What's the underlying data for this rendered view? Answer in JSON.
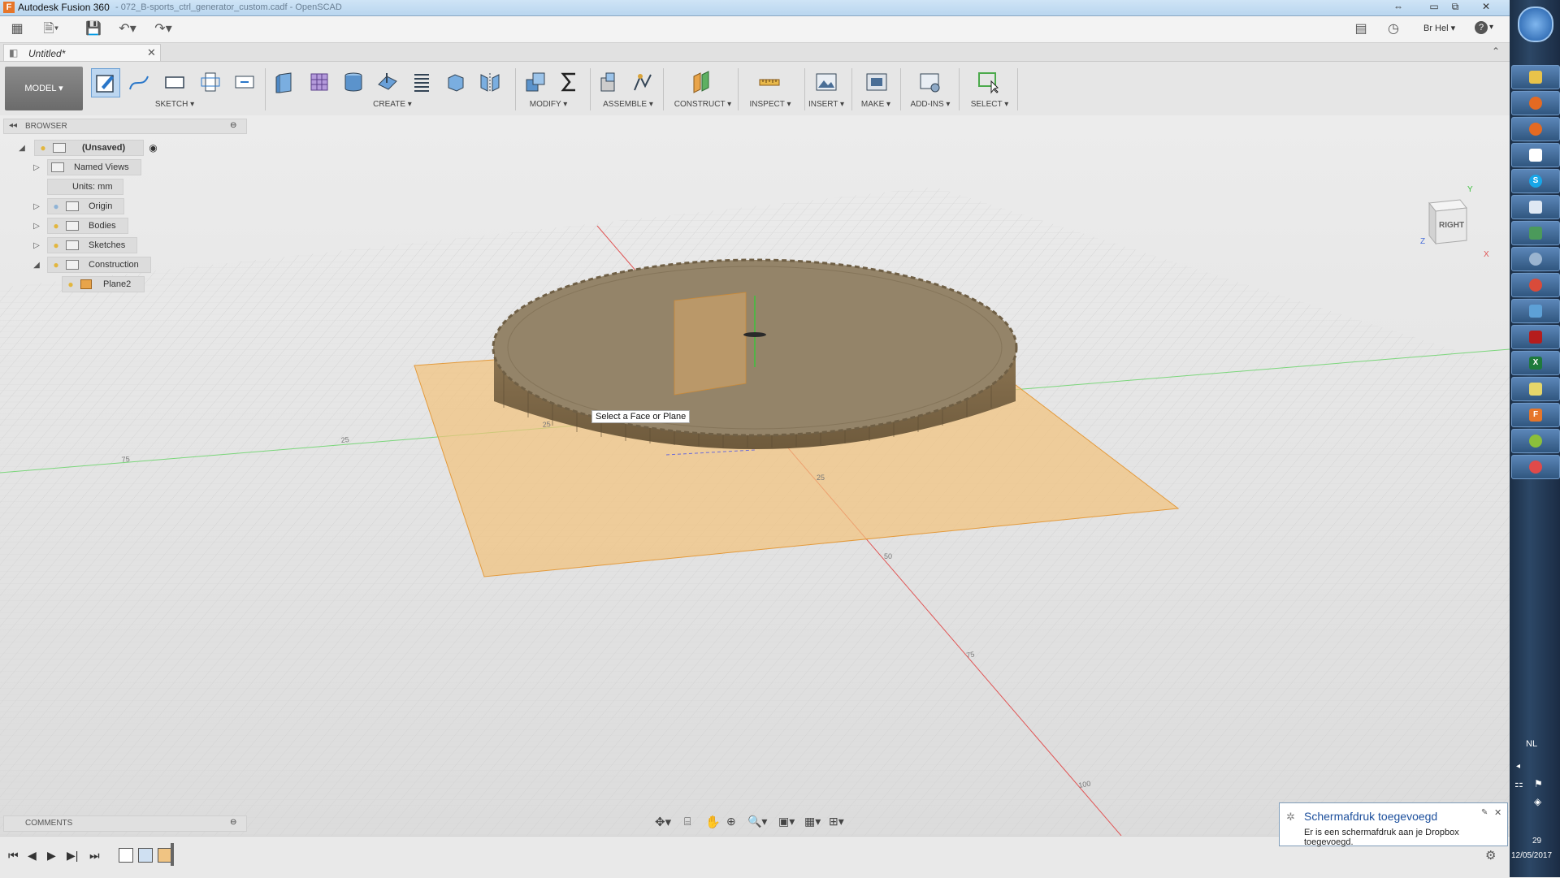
{
  "window": {
    "title": "Autodesk Fusion 360",
    "file_path": "- 072_B-sports_ctrl_generator_custom.cadf - OpenSCAD"
  },
  "header": {
    "user": "Br Hel",
    "help": "?"
  },
  "document_tab": {
    "label": "Untitled*"
  },
  "toolbar": {
    "workspace": "MODEL",
    "groups": [
      {
        "label": "SKETCH"
      },
      {
        "label": "CREATE"
      },
      {
        "label": "MODIFY"
      },
      {
        "label": "ASSEMBLE"
      },
      {
        "label": "CONSTRUCT"
      },
      {
        "label": "INSPECT"
      },
      {
        "label": "INSERT"
      },
      {
        "label": "MAKE"
      },
      {
        "label": "ADD-INS"
      },
      {
        "label": "SELECT"
      }
    ]
  },
  "browser": {
    "title": "BROWSER",
    "root": "(Unsaved)",
    "items": [
      {
        "label": "Named Views"
      },
      {
        "label": "Units: mm"
      },
      {
        "label": "Origin"
      },
      {
        "label": "Bodies"
      },
      {
        "label": "Sketches"
      },
      {
        "label": "Construction"
      },
      {
        "label": "Plane2"
      }
    ]
  },
  "viewport": {
    "tooltip": "Select a Face or Plane",
    "viewcube_label": "RIGHT",
    "axis_labels": {
      "y": "Y",
      "z": "Z",
      "x": "X"
    },
    "ruler_ticks": [
      "75",
      "25",
      "25",
      "25",
      "50",
      "75",
      "100"
    ]
  },
  "comments": {
    "title": "COMMENTS"
  },
  "notification": {
    "title": "Schermafdruk toegevoegd",
    "body": "Er is een schermafdruk aan je Dropbox toegevoegd."
  },
  "system_tray": {
    "language": "NL",
    "time": "29",
    "date": "12/05/2017"
  },
  "colors": {
    "accent": "#e8a44a",
    "plane": "#f2c27a",
    "gear": "#8c7a5c",
    "taskbar": "#243b57"
  }
}
